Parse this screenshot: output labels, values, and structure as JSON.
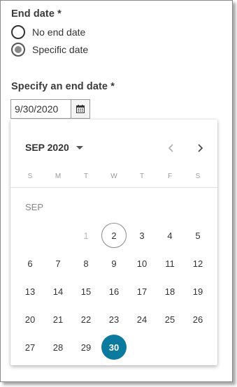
{
  "end_date": {
    "label": "End date *",
    "options": [
      {
        "label": "No end date",
        "checked": false
      },
      {
        "label": "Specific date",
        "checked": true
      }
    ]
  },
  "specify": {
    "label": "Specify an end date *",
    "value": "9/30/2020",
    "calendar_icon": "calendar-icon"
  },
  "datepicker": {
    "month_year": "SEP 2020",
    "prev_icon": "chevron-left-icon",
    "next_icon": "chevron-right-icon",
    "weekdays": [
      "S",
      "M",
      "T",
      "W",
      "T",
      "F",
      "S"
    ],
    "month_label": "SEP",
    "first_weekday_index": 2,
    "days_in_month": 30,
    "disabled_days": [
      1
    ],
    "today": 2,
    "selected": 30,
    "colors": {
      "selected_bg": "#0c7a9e",
      "disabled_text": "#bdbdbd"
    }
  }
}
